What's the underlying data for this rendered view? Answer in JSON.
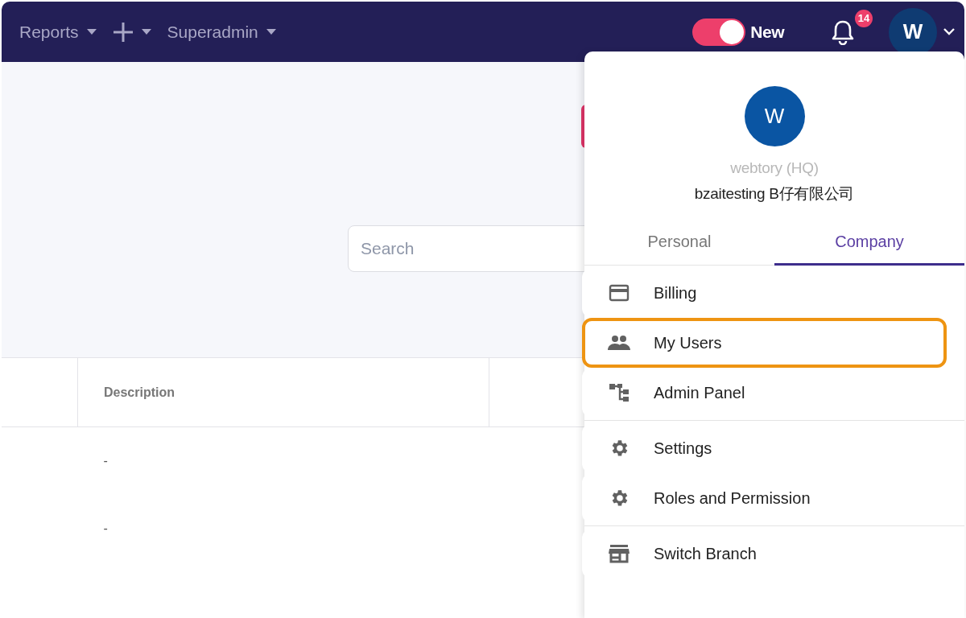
{
  "top_bar": {
    "menus": [
      {
        "kind": "text",
        "label": "Reports"
      },
      {
        "kind": "plus"
      },
      {
        "kind": "text",
        "label": "Superadmin"
      }
    ],
    "new_toggle": {
      "label": "New",
      "on": true
    },
    "notifications": {
      "badge": "14"
    },
    "avatar": {
      "initial": "W"
    }
  },
  "search": {
    "placeholder": "Search"
  },
  "table": {
    "columns": [
      "Description"
    ],
    "rows": [
      {
        "description": "-"
      },
      {
        "description": "-"
      }
    ]
  },
  "account_menu": {
    "avatar": {
      "initial": "W"
    },
    "branch": "webtory (HQ)",
    "company": "bzaitesting B仔有限公司",
    "tabs": [
      {
        "label": "Personal",
        "selected": false
      },
      {
        "label": "Company",
        "selected": true
      }
    ],
    "groups": [
      [
        {
          "kind": "card",
          "label": "Billing",
          "highlighted": false
        },
        {
          "kind": "people",
          "label": "My Users",
          "highlighted": true
        },
        {
          "kind": "tree",
          "label": "Admin Panel",
          "highlighted": false
        }
      ],
      [
        {
          "kind": "gear",
          "label": "Settings",
          "highlighted": false
        },
        {
          "kind": "gear",
          "label": "Roles and Permission",
          "highlighted": false
        }
      ],
      [
        {
          "kind": "store",
          "label": "Switch Branch",
          "highlighted": false
        }
      ]
    ]
  }
}
